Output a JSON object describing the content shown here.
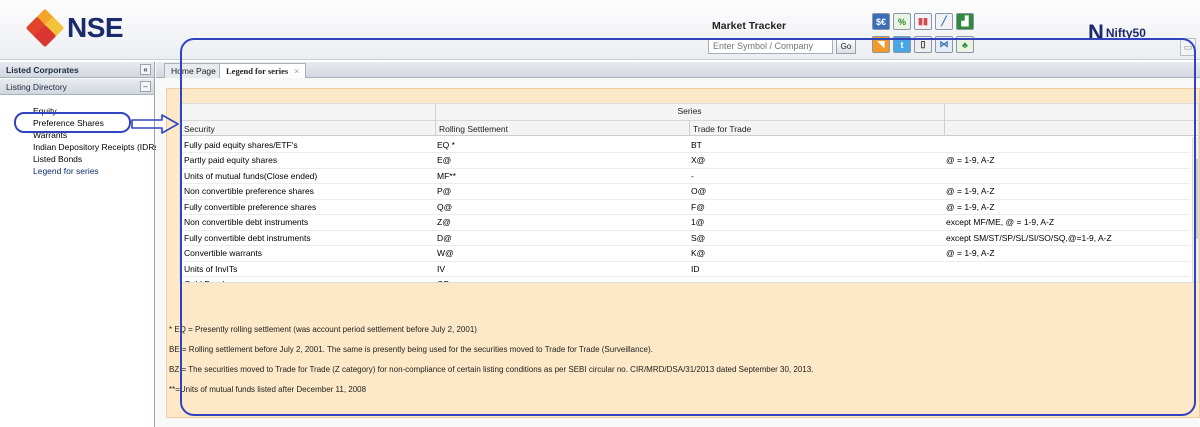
{
  "header": {
    "logo_text": "NSE",
    "market_tracker_title": "Market Tracker",
    "symbol_placeholder": "Enter Symbol / Company",
    "go_label": "Go",
    "nifty_logo": "Nifty50",
    "toolbar_icons": [
      "currency-icon",
      "percent-icon",
      "bar-chart-icon",
      "line-chart-icon",
      "map-icon",
      "rss-icon",
      "twitter-icon",
      "mobile-icon",
      "network-icon",
      "tree-icon"
    ]
  },
  "sidebar": {
    "panel_title": "Listed Corporates",
    "collapse_label": "«",
    "section_title": "Listing Directory",
    "section_toggle": "–",
    "items": [
      {
        "label": "Equity"
      },
      {
        "label": "Preference Shares"
      },
      {
        "label": "Warrants"
      },
      {
        "label": "Indian Depository Receipts (IDRs"
      },
      {
        "label": "Listed Bonds"
      },
      {
        "label": "Legend for series"
      }
    ]
  },
  "tabs": [
    {
      "label": "Home Page"
    },
    {
      "label": "Legend for series",
      "close": "×"
    }
  ],
  "legend_table": {
    "group_header": "Series",
    "headers": [
      "Security",
      "Rolling Settlement",
      "Trade for Trade",
      ""
    ],
    "rows": [
      [
        "Fully paid equity shares/ETF's",
        "EQ *",
        "BT",
        ""
      ],
      [
        "Partly paid equity shares",
        "E@",
        "X@",
        "@ = 1-9, A-Z"
      ],
      [
        "Units of mutual funds(Close ended)",
        "MF**",
        "-",
        ""
      ],
      [
        "Non convertible preference shares",
        "P@",
        "O@",
        "@ = 1-9, A-Z"
      ],
      [
        "Fully convertible preference shares",
        "Q@",
        "F@",
        "@ = 1-9, A-Z"
      ],
      [
        "Non convertible debt instruments",
        "Z@",
        "1@",
        "except MF/ME, @ = 1-9, A-Z"
      ],
      [
        "Fully convertible debt instruments",
        "D@",
        "S@",
        "except SM/ST/SP/SL/SI/SO/SQ,@=1-9, A-Z"
      ],
      [
        "Convertible warrants",
        "W@",
        "K@",
        "@ = 1-9, A-Z"
      ],
      [
        "Units of InvITs",
        "IV",
        "ID",
        ""
      ],
      [
        "Gold Bond",
        "GB",
        "-",
        ""
      ]
    ]
  },
  "notes": [
    "* EQ = Presently rolling settlement (was account period settlement before July 2, 2001)",
    "BE = Rolling settlement before July 2, 2001. The same is presently being used for the securities moved to Trade for Trade (Surveillance).",
    "BZ = The securities moved to Trade for Trade (Z category) for non-compliance of certain listing conditions as per SEBI circular no. CIR/MRD/DSA/31/2013 dated September 30, 2013.",
    "**=Units of mutual funds listed after December 11, 2008"
  ],
  "colors": {
    "highlight": "#3243bf",
    "content_bg": "#fde9c7",
    "brand_navy": "#1b2a6b"
  }
}
